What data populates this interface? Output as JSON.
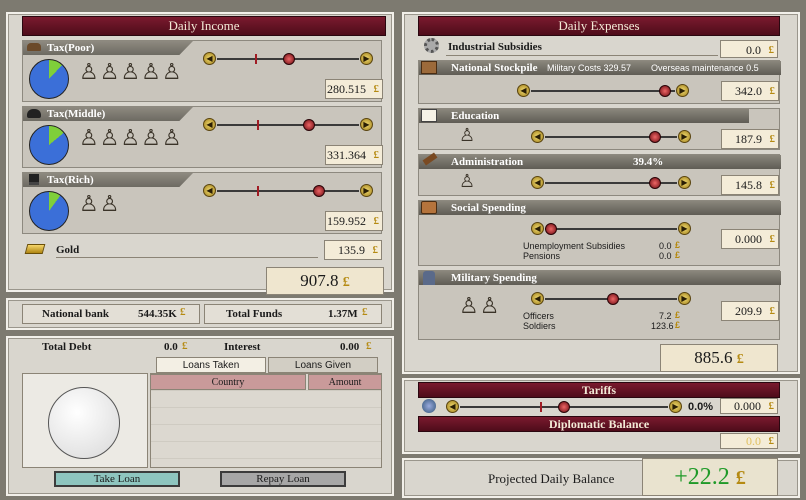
{
  "income": {
    "title": "Daily Income",
    "poor": {
      "label": "Tax(Poor)",
      "value": "280.515",
      "slider_pct": 0.55
    },
    "middle": {
      "label": "Tax(Middle)",
      "value": "331.364",
      "slider_pct": 0.66
    },
    "rich": {
      "label": "Tax(Rich)",
      "value": "159.952",
      "slider_pct": 0.72
    },
    "gold": {
      "label": "Gold",
      "value": "135.9"
    },
    "total": "907.8"
  },
  "funds": {
    "bank_label": "National bank",
    "bank_value": "544.35K",
    "total_label": "Total Funds",
    "total_value": "1.37M"
  },
  "loans": {
    "debt_label": "Total Debt",
    "debt_value": "0.0",
    "interest_label": "Interest",
    "interest_value": "0.00",
    "tab_taken": "Loans Taken",
    "tab_given": "Loans Given",
    "col_country": "Country",
    "col_amount": "Amount",
    "take_label": "Take Loan",
    "repay_label": "Repay Loan"
  },
  "expenses": {
    "title": "Daily Expenses",
    "industrial": {
      "label": "Industrial Subsidies",
      "value": "0.0"
    },
    "stockpile": {
      "label": "National Stockpile",
      "mil_costs_label": "Military Costs",
      "mil_costs_value": "329.57",
      "overseas_label": "Overseas maintenance",
      "overseas_value": "0.5",
      "value": "342.0",
      "slider_pct": 0.9
    },
    "education": {
      "label": "Education",
      "value": "187.9",
      "slider_pct": 0.8
    },
    "administration": {
      "label": "Administration",
      "percent": "39.4%",
      "value": "145.8",
      "slider_pct": 0.8
    },
    "social": {
      "label": "Social Spending",
      "unemp_label": "Unemployment Subsidies",
      "unemp_value": "0.0",
      "pens_label": "Pensions",
      "pens_value": "0.0",
      "value": "0.000",
      "slider_pct": 0.02
    },
    "military": {
      "label": "Military Spending",
      "officers_label": "Officers",
      "officers_value": "7.2",
      "soldiers_label": "Soldiers",
      "soldiers_value": "123.6",
      "value": "209.9",
      "slider_pct": 0.55
    },
    "total": "885.6"
  },
  "tariffs": {
    "title": "Tariffs",
    "percent": "0.0%",
    "value": "0.000",
    "slider_pct": 0.5
  },
  "diplomatic": {
    "title": "Diplomatic Balance",
    "value": "0.0"
  },
  "projected": {
    "label": "Projected Daily Balance",
    "value": "+22.2"
  },
  "currency": "£",
  "colors": {
    "header": "#5e1222",
    "pie_blue": "#3b6fd8",
    "pie_green": "#7fcf3a",
    "balance_green": "#1f9a28"
  }
}
